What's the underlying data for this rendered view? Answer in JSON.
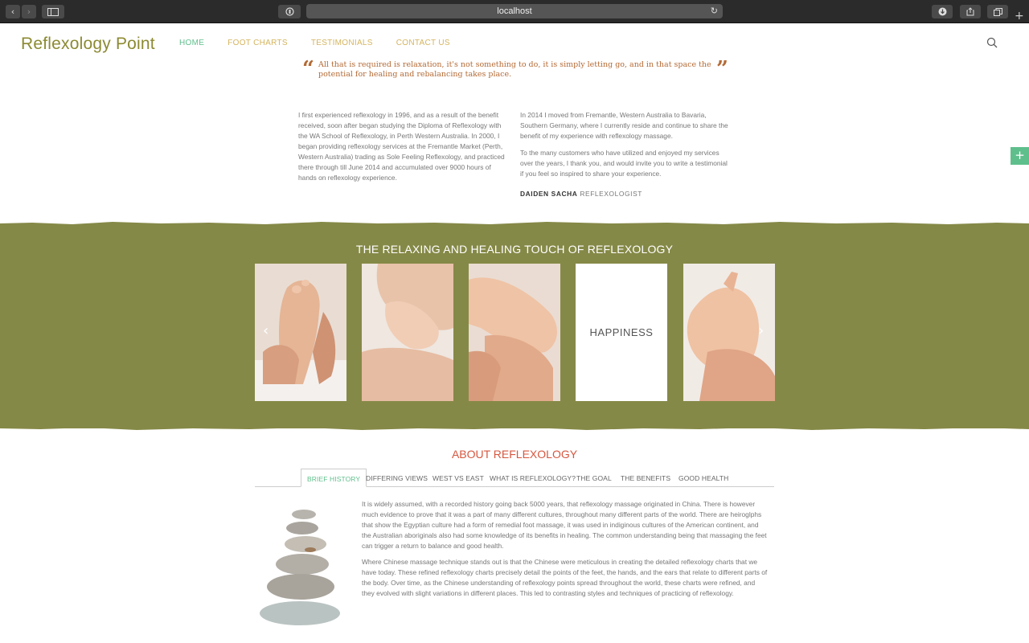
{
  "browser": {
    "url": "localhost"
  },
  "header": {
    "logo": "Reflexology Point",
    "nav": [
      {
        "label": "HOME"
      },
      {
        "label": "FOOT CHARTS"
      },
      {
        "label": "TESTIMONIALS"
      },
      {
        "label": "CONTACT US"
      }
    ]
  },
  "quote": {
    "text": "All that is required is relaxation, it's not something to do, it is simply letting go, and in that space the potential for healing and rebalancing takes place."
  },
  "bio": {
    "left_paragraph": "I first experienced reflexology in 1996, and as a result of the benefit received, soon after began studying the Diploma of Reflexology with the WA School of Reflexology, in Perth Western Australia. In 2000, I began providing reflexology services at the Fremantle Market (Perth, Western Australia) trading as Sole Feeling Reflexology, and practiced there through till June 2014 and accumulated over 9000 hours of hands on reflexology experience.",
    "right_paragraph_1": "In 2014 I moved from Fremantle, Western Australia to Bavaria, Southern Germany, where I currently reside and continue to share the benefit of my experience with reflexology massage.",
    "right_paragraph_2": "To the many customers who have utilized and enjoyed my services over the years, I thank you, and would invite you to write a testimonial if you feel so inspired to share your experience.",
    "signature_name": "DAIDEN SACHA",
    "signature_role": "REFLEXOLOGIST"
  },
  "carousel": {
    "title": "THE RELAXING AND HEALING TOUCH OF REFLEXOLOGY",
    "text_slide": "HAPPINESS"
  },
  "about": {
    "title": "ABOUT REFLEXOLOGY",
    "tabs": [
      {
        "label": "BRIEF HISTORY"
      },
      {
        "label": "DIFFERING VIEWS"
      },
      {
        "label": "WEST VS EAST"
      },
      {
        "label": "WHAT IS REFLEXOLOGY?"
      },
      {
        "label": "THE GOAL"
      },
      {
        "label": "THE BENEFITS"
      },
      {
        "label": "GOOD HEALTH"
      }
    ],
    "paragraph_1": "It is widely assumed, with a recorded history going back 5000 years, that reflexology massage originated in China. There is however much evidence to prove that it was a part of many different cultures, throughout many different parts of the world. There are heiroglphs that show the Egyptian culture had a form of remedial foot massage, it was used in indiginous cultures of the American continent, and the Australian aboriginals also had some knowledge of its benefits in healing. The common understanding being that massaging the feet can trigger a return to balance and good health.",
    "paragraph_2": "Where Chinese massage technique stands out is that the Chinese were meticulous in creating the detailed reflexology charts that we have today. These refined reflexology charts precisely detail the points of the feet, the hands, and the ears that relate to different parts of the body. Over time, as the Chinese understanding of reflexology points spread throughout the world, these charts were refined, and they evolved with slight variations in different places. This led to contrasting styles and techniques of practicing of reflexology."
  },
  "colors": {
    "accent_green": "#5fbf8c",
    "olive": "#858947",
    "logo": "#8c8a32",
    "nav": "#d4b45e",
    "quote": "#b46a35",
    "about_title": "#d6573f"
  }
}
